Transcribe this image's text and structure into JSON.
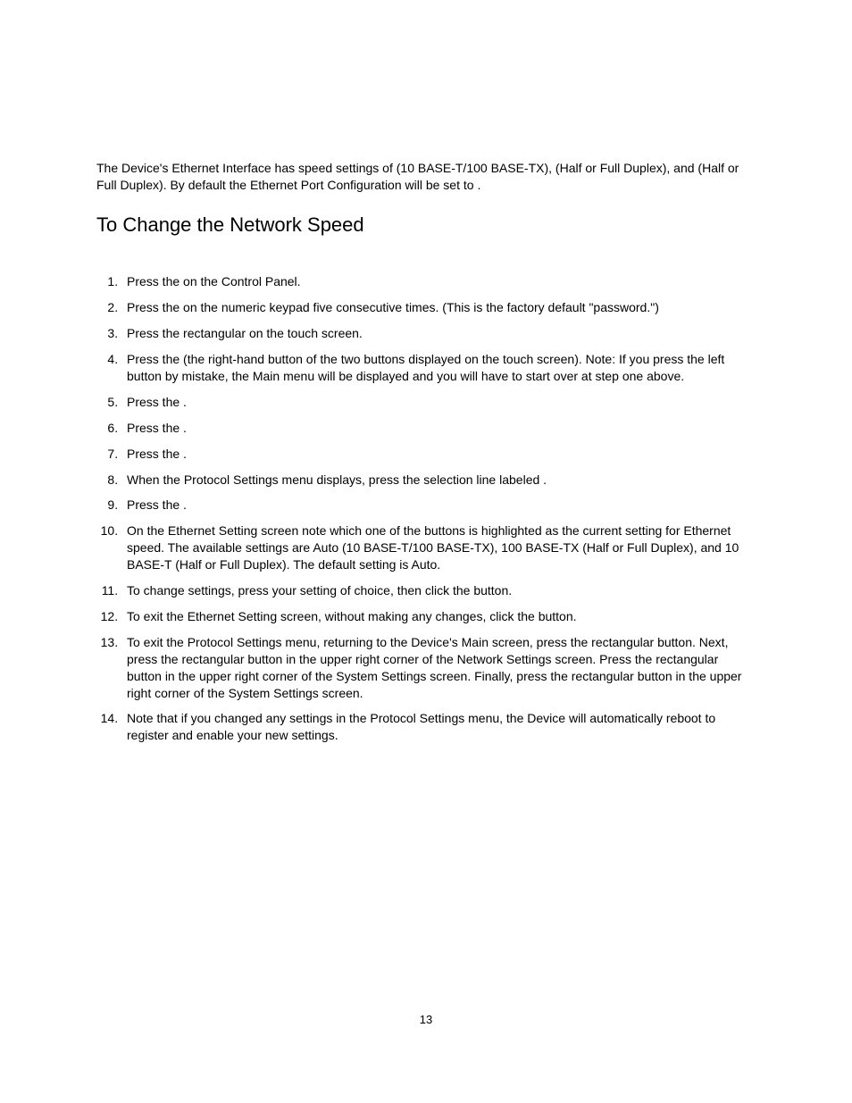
{
  "intro": "The Device's Ethernet Interface has speed settings of          (10 BASE-T/100 BASE-TX),                        (Half or Full Duplex), and                     (Half or Full Duplex).  By default the Ethernet Port Configuration will be set to           .",
  "heading": "To Change the Network Speed",
  "steps": [
    "Press the                                       on the Control Panel.",
    "Press the                on the numeric keypad five consecutive times.  (This is the factory default \"password.\")",
    "Press the rectangular                               on the touch screen.",
    "Press the                                              (the right-hand button of the two buttons displayed on the touch screen).  Note:  If you press the left button by mistake, the Main menu will be displayed and you will have to start over at step one above.",
    "Press the                                                   .",
    "Press the                                                    .",
    "Press the                                                   .",
    "When the Protocol Settings menu displays, press the selection line labeled                                    .",
    "Press the                                                   .",
    "On the Ethernet Setting screen note which one of the buttons is highlighted as the current setting for Ethernet speed.  The available settings are Auto (10 BASE-T/100 BASE-TX), 100 BASE-TX (Half or Full Duplex), and 10 BASE-T (Half or Full Duplex).  The default setting is Auto.",
    "To change settings, press your setting of choice, then click the           button.",
    "To exit the Ethernet Setting screen, without making any changes, click the               button.",
    "To exit the Protocol Settings menu, returning to the Device's Main screen, press the rectangular              button.  Next, press the rectangular              button in the upper right corner of the Network Settings screen.  Press the rectangular              button in the upper right corner of the System Settings screen.  Finally, press the rectangular             button in the upper right corner of the System Settings screen.",
    "Note that if you changed any settings in the Protocol Settings menu, the Device will automatically reboot to register and enable your new settings."
  ],
  "page_number": "13"
}
